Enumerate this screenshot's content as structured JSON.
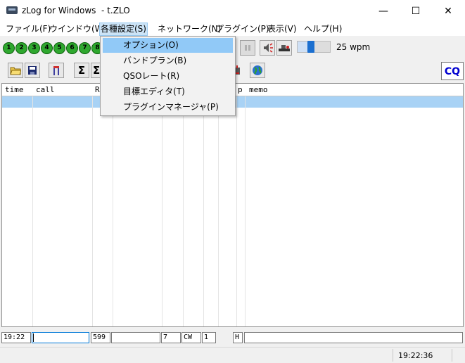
{
  "window": {
    "title": "zLog for Windows  - t.ZLO",
    "minimize_glyph": "—",
    "maximize_glyph": "☐",
    "close_glyph": "✕"
  },
  "menubar": [
    {
      "label": "ファイル(F)"
    },
    {
      "label": "ウインドウ(W)"
    },
    {
      "label": "各種設定(S)"
    },
    {
      "label": "ネットワーク(N)"
    },
    {
      "label": "プラグイン(P)"
    },
    {
      "label": "表示(V)"
    },
    {
      "label": "ヘルプ(H)"
    }
  ],
  "dropdown": {
    "items": [
      {
        "label": "オプション(O)",
        "highlighted": true
      },
      {
        "label": "バンドプラン(B)"
      },
      {
        "label": "QSOレート(R)"
      },
      {
        "label": "目標エディタ(T)"
      },
      {
        "label": "プラグインマネージャ(P)"
      }
    ]
  },
  "toolbar1": {
    "cw_buttons": [
      "1",
      "2",
      "3",
      "4",
      "5",
      "6",
      "7",
      "8"
    ],
    "cw_speed_value": 25,
    "wpm_label": "25 wpm",
    "icons": [
      "pause-icon",
      "speaker-icon",
      "paddle-icon"
    ]
  },
  "toolbar2": {
    "cq_label": "CQ",
    "icons": [
      "open-folder-icon",
      "save-icon",
      "flag-icon",
      "sigma-icon",
      "sigma-icon-2",
      "radio-icon",
      "globe-icon"
    ]
  },
  "grid": {
    "columns": [
      "time",
      "call",
      "R",
      "p",
      "memo"
    ]
  },
  "entry": {
    "time": "19:22",
    "call": "",
    "rst": "599",
    "number": "",
    "band": "7",
    "mode": "CW",
    "power": "1",
    "op": "H",
    "memo": ""
  },
  "status": {
    "clock": "19:22:36"
  },
  "colors": {
    "menu_highlight": "#91c9f7",
    "selected_row": "#a8d2f5",
    "cw_button": "#2fa82f",
    "cq_text": "#0000d0",
    "slider_thumb": "#1b6fd0"
  }
}
